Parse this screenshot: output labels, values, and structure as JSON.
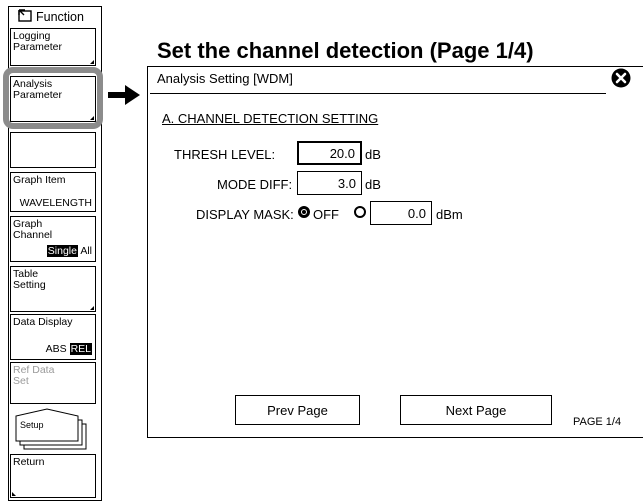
{
  "heading": "Set the channel detection (Page 1/4)",
  "softkeys": {
    "title": "Function",
    "logging_parameter": [
      "Logging",
      "Parameter"
    ],
    "analysis_parameter": [
      "Analysis",
      "Parameter"
    ],
    "graph_item": {
      "label": "Graph Item",
      "value": "WAVELENGTH"
    },
    "graph_channel": {
      "label": [
        "Graph",
        "Channel"
      ],
      "opt_single": "Single",
      "opt_all": "All",
      "selected": "Single"
    },
    "table_setting": [
      "Table",
      "Setting"
    ],
    "data_display": {
      "label": "Data Display",
      "opt_abs": "ABS",
      "opt_rel": "REL",
      "selected": "REL"
    },
    "ref_data_set": [
      "Ref Data",
      "Set"
    ],
    "setup": "Setup",
    "return": "Return"
  },
  "dialog": {
    "title": "Analysis Setting [WDM]",
    "section": "A. CHANNEL DETECTION SETTING",
    "thresh_level": {
      "label": "THRESH LEVEL:",
      "value": "20.0",
      "unit": "dB"
    },
    "mode_diff": {
      "label": "MODE DIFF:",
      "value": "3.0",
      "unit": "dB"
    },
    "display_mask": {
      "label": "DISPLAY MASK:",
      "off_label": "OFF",
      "value": "0.0",
      "unit": "dBm",
      "selected": "OFF"
    },
    "prev_button": "Prev Page",
    "next_button": "Next Page",
    "page_indicator": "PAGE 1/4"
  }
}
